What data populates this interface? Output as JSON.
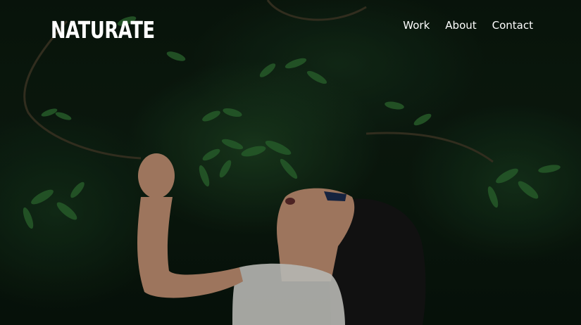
{
  "brand": {
    "name": "NATURATE"
  },
  "nav": {
    "items": [
      {
        "label": "Work"
      },
      {
        "label": "About"
      },
      {
        "label": "Contact"
      }
    ]
  },
  "hero": {
    "image": "hero-photo",
    "accent_color": "#ffffff",
    "background_color": "#0a170d"
  }
}
